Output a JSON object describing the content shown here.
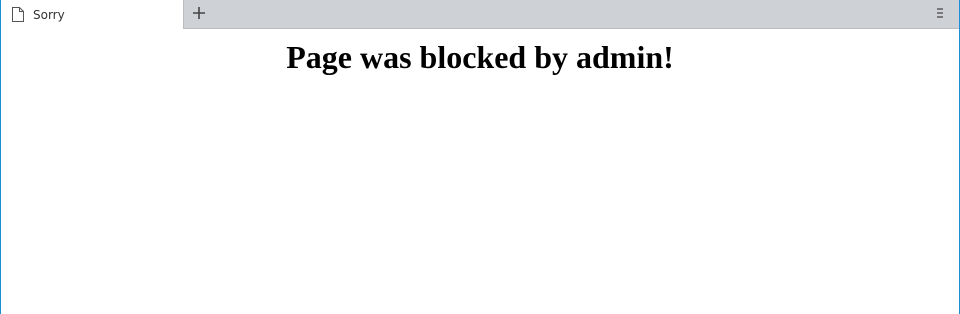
{
  "browser": {
    "tab": {
      "title": "Sorry",
      "icon": "page-icon"
    },
    "new_tab_icon": "plus-icon",
    "menu_icon": "menu-icon",
    "colors": {
      "tabbar_bg": "#ced1d6",
      "active_tab_bg": "#ffffff",
      "window_border": "#1a8fd8"
    }
  },
  "page": {
    "heading": "Page was blocked by admin!"
  }
}
